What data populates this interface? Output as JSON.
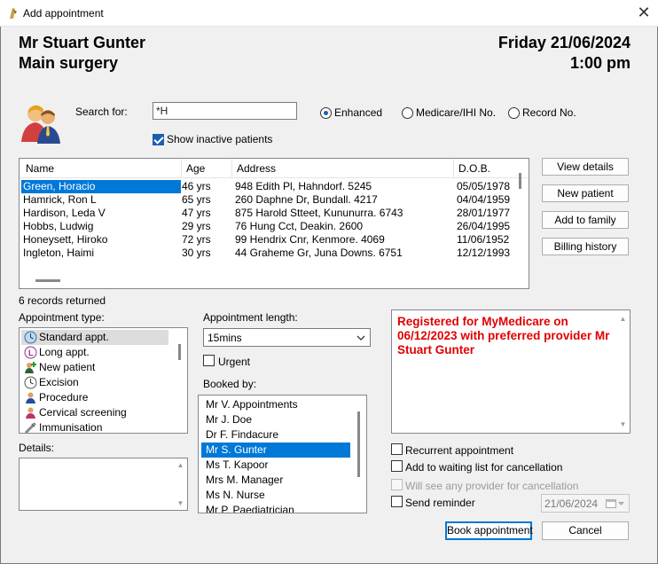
{
  "window": {
    "title": "Add appointment"
  },
  "header": {
    "patient_name": "Mr Stuart Gunter",
    "location": "Main surgery",
    "date": "Friday 21/06/2024",
    "time": "1:00 pm"
  },
  "search": {
    "label": "Search for:",
    "value": "*H",
    "options": [
      "Enhanced",
      "Medicare/IHI No.",
      "Record No."
    ],
    "selected": "Enhanced",
    "show_inactive_label": "Show inactive patients",
    "show_inactive_checked": true
  },
  "patients": {
    "columns": [
      "Name",
      "Age",
      "Address",
      "D.O.B."
    ],
    "rows": [
      {
        "name": "Green, Horacio",
        "age": "46 yrs",
        "address": "948 Edith Pl, Hahndorf. 5245",
        "dob": "05/05/1978"
      },
      {
        "name": "Hamrick, Ron L",
        "age": "65 yrs",
        "address": "260 Daphne Dr, Bundall. 4217",
        "dob": "04/04/1959"
      },
      {
        "name": "Hardison, Leda V",
        "age": "47 yrs",
        "address": "875 Harold Stteet, Kununurra. 6743",
        "dob": "28/01/1977"
      },
      {
        "name": "Hobbs, Ludwig",
        "age": "29 yrs",
        "address": "76 Hung Cct, Deakin. 2600",
        "dob": "26/04/1995"
      },
      {
        "name": "Honeysett, Hiroko",
        "age": "72 yrs",
        "address": "99 Hendrix Cnr, Kenmore. 4069",
        "dob": "11/06/1952"
      },
      {
        "name": "Ingleton, Haimi",
        "age": "30 yrs",
        "address": "44 Graheme Gr, Juna Downs. 6751",
        "dob": "12/12/1993"
      }
    ],
    "selected_index": 0,
    "records_text": "6 records returned"
  },
  "side_buttons": [
    "View details",
    "New patient",
    "Add to family",
    "Billing history"
  ],
  "appointment_type": {
    "label": "Appointment type:",
    "items": [
      {
        "label": "Standard appt.",
        "icon": "clock-icon"
      },
      {
        "label": "Long appt.",
        "icon": "long-l-icon"
      },
      {
        "label": "New patient",
        "icon": "new-patient-icon"
      },
      {
        "label": "Excision",
        "icon": "clock-icon"
      },
      {
        "label": "Procedure",
        "icon": "person-icon"
      },
      {
        "label": "Cervical screening",
        "icon": "person-icon"
      },
      {
        "label": "Immunisation",
        "icon": "syringe-icon"
      }
    ],
    "selected_index": 0
  },
  "details": {
    "label": "Details:",
    "value": ""
  },
  "appointment_length": {
    "label": "Appointment length:",
    "value": "15mins"
  },
  "urgent": {
    "label": "Urgent",
    "checked": false
  },
  "booked_by": {
    "label": "Booked by:",
    "items": [
      "Mr V. Appointments",
      "Mr J. Doe",
      "Dr F. Findacure",
      "Mr S. Gunter",
      "Ms T. Kapoor",
      "Mrs M. Manager",
      "Ms N. Nurse",
      "Mr P. Paediatrician"
    ],
    "selected_index": 3
  },
  "note": {
    "text": "Registered for MyMedicare on 06/12/2023 with preferred provider Mr Stuart Gunter",
    "color": "#e00000"
  },
  "options": {
    "recurrent_label": "Recurrent appointment",
    "waiting_list_label": "Add to waiting list for cancellation",
    "any_provider_label": "Will see any provider for cancellation",
    "reminder_label": "Send reminder",
    "reminder_date": "21/06/2024"
  },
  "actions": {
    "book": "Book appointment",
    "cancel": "Cancel"
  },
  "colors": {
    "accent": "#0078d7",
    "selection": "#0078d7",
    "note": "#e00000"
  }
}
